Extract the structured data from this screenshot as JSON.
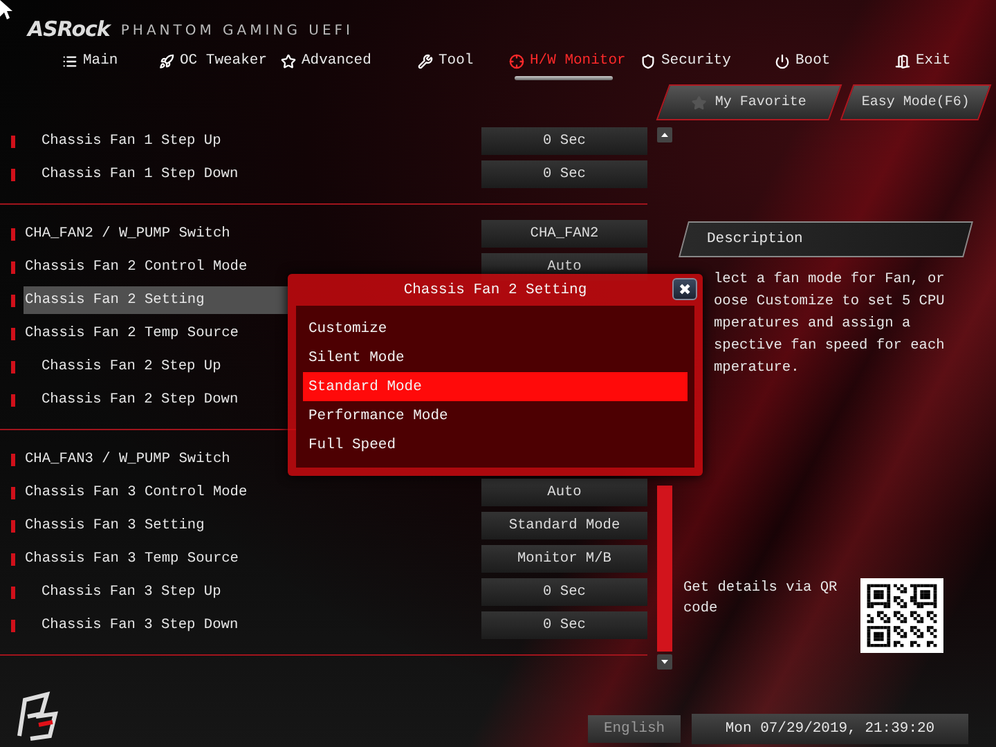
{
  "header": {
    "brand": "ASRock",
    "product": "PHANTOM GAMING UEFI"
  },
  "tabs": [
    {
      "label": "Main",
      "selected": false
    },
    {
      "label": "OC Tweaker",
      "selected": false
    },
    {
      "label": "Advanced",
      "selected": false
    },
    {
      "label": "Tool",
      "selected": false
    },
    {
      "label": "H/W Monitor",
      "selected": true
    },
    {
      "label": "Security",
      "selected": false
    },
    {
      "label": "Boot",
      "selected": false
    },
    {
      "label": "Exit",
      "selected": false
    }
  ],
  "quick_buttons": [
    "My Favorite",
    "Easy Mode(F6)"
  ],
  "settings": [
    [
      {
        "kind": "sub",
        "label": "Chassis Fan 1 Step Up",
        "value": "0 Sec",
        "selected": false
      },
      {
        "kind": "sub",
        "label": "Chassis Fan 1 Step Down",
        "value": "0 Sec",
        "selected": false
      }
    ],
    [
      {
        "kind": "main",
        "label": "CHA_FAN2 / W_PUMP Switch",
        "value": "CHA_FAN2",
        "selected": false
      },
      {
        "kind": "main",
        "label": "Chassis Fan 2 Control Mode",
        "value": "Auto",
        "selected": false
      },
      {
        "kind": "main",
        "label": "Chassis Fan 2 Setting",
        "selected": true
      },
      {
        "kind": "main",
        "label": "Chassis Fan 2 Temp Source",
        "selected": false
      },
      {
        "kind": "sub",
        "label": "Chassis Fan 2 Step Up",
        "selected": false
      },
      {
        "kind": "sub",
        "label": "Chassis Fan 2 Step Down",
        "selected": false
      }
    ],
    [
      {
        "kind": "main",
        "label": "CHA_FAN3 / W_PUMP Switch",
        "selected": false
      },
      {
        "kind": "main",
        "label": "Chassis Fan 3 Control Mode",
        "value": "Auto",
        "selected": false
      },
      {
        "kind": "main",
        "label": "Chassis Fan 3 Setting",
        "value": "Standard Mode",
        "selected": false
      },
      {
        "kind": "main",
        "label": "Chassis Fan 3 Temp Source",
        "value": "Monitor M/B",
        "selected": false
      },
      {
        "kind": "sub",
        "label": "Chassis Fan 3 Step Up",
        "value": "0 Sec",
        "selected": false
      },
      {
        "kind": "sub",
        "label": "Chassis Fan 3 Step Down",
        "value": "0 Sec",
        "selected": false
      }
    ]
  ],
  "description": {
    "title": "Description",
    "lines": [
      "lect a fan mode for Fan, or",
      "oose Customize to set 5 CPU",
      "mperatures and assign a",
      "spective fan speed for each",
      "mperature."
    ]
  },
  "qr": {
    "caption": "Get details via QR code"
  },
  "dialog": {
    "title": "Chassis Fan 2 Setting",
    "close": "✖",
    "options": [
      {
        "label": "Customize",
        "selected": false
      },
      {
        "label": "Silent Mode",
        "selected": false
      },
      {
        "label": "Standard Mode",
        "selected": true
      },
      {
        "label": "Performance Mode",
        "selected": false
      },
      {
        "label": "Full Speed",
        "selected": false
      }
    ]
  },
  "footer": {
    "language": "English",
    "datetime": "Mon 07/29/2019, 21:39:20"
  }
}
